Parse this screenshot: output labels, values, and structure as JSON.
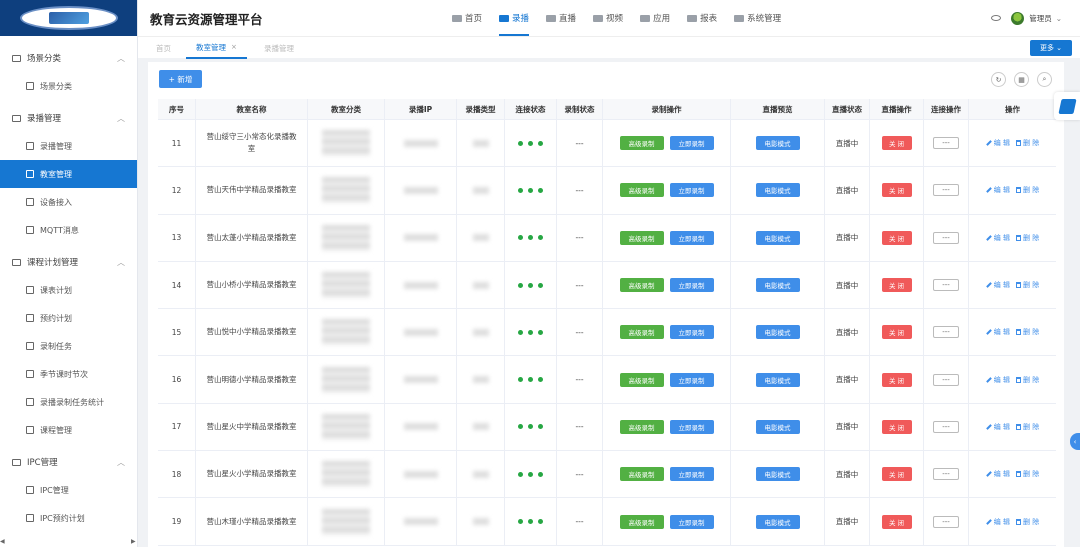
{
  "header": {
    "title": "教育云资源管理平台",
    "nav": [
      {
        "label": "首页",
        "icon": "home-icon",
        "active": false
      },
      {
        "label": "录播",
        "icon": "camera-icon",
        "active": true
      },
      {
        "label": "直播",
        "icon": "live-icon",
        "active": false
      },
      {
        "label": "视频",
        "icon": "video-icon",
        "active": false
      },
      {
        "label": "应用",
        "icon": "apps-icon",
        "active": false
      },
      {
        "label": "报表",
        "icon": "report-icon",
        "active": false
      },
      {
        "label": "系统管理",
        "icon": "system-icon",
        "active": false
      }
    ],
    "user": "管理员"
  },
  "sidebar": {
    "groups": [
      {
        "label": "场景分类",
        "items": [
          {
            "label": "场景分类"
          }
        ]
      },
      {
        "label": "录播管理",
        "items": [
          {
            "label": "录播管理"
          },
          {
            "label": "教室管理"
          },
          {
            "label": "设备接入"
          },
          {
            "label": "MQTT消息"
          }
        ]
      },
      {
        "label": "课程计划管理",
        "items": [
          {
            "label": "课表计划"
          },
          {
            "label": "预约计划"
          },
          {
            "label": "录制任务"
          },
          {
            "label": "季节课时节次"
          },
          {
            "label": "录播录制任务统计"
          },
          {
            "label": "课程管理"
          }
        ]
      },
      {
        "label": "IPC管理",
        "items": [
          {
            "label": "IPC管理"
          },
          {
            "label": "IPC预约计划"
          }
        ]
      }
    ],
    "active_item": "教室管理"
  },
  "tabs": [
    {
      "label": "首页"
    },
    {
      "label": "教室管理",
      "close": "×"
    },
    {
      "label": "录播管理"
    }
  ],
  "toolbar": {
    "more_label": "更多",
    "add_label": "+ 新增",
    "refresh_icon": "↻",
    "grid_icon": "▦",
    "search_icon": "⌕"
  },
  "table": {
    "headers": [
      "序号",
      "教室名称",
      "教室分类",
      "录播IP",
      "录播类型",
      "连接状态",
      "录制状态",
      "录制操作",
      "直播预览",
      "直播状态",
      "直播操作",
      "连接操作",
      "操作"
    ],
    "rows": [
      {
        "seq": "11",
        "name": "营山绥守三小常态化录播教室",
        "record_status": "---",
        "live_status": "直播中"
      },
      {
        "seq": "12",
        "name": "营山天伟中学精品录播教室",
        "record_status": "---",
        "live_status": "直播中"
      },
      {
        "seq": "13",
        "name": "营山太蓬小学精品录播教室",
        "record_status": "---",
        "live_status": "直播中"
      },
      {
        "seq": "14",
        "name": "营山小桥小学精品录播教室",
        "record_status": "---",
        "live_status": "直播中"
      },
      {
        "seq": "15",
        "name": "营山悦中小学精品录播教室",
        "record_status": "---",
        "live_status": "直播中"
      },
      {
        "seq": "16",
        "name": "营山明德小学精品录播教室",
        "record_status": "---",
        "live_status": "直播中"
      },
      {
        "seq": "17",
        "name": "营山星火中学精品录播教室",
        "record_status": "---",
        "live_status": "直播中"
      },
      {
        "seq": "18",
        "name": "营山星火小学精品录播教室",
        "record_status": "---",
        "live_status": "直播中"
      },
      {
        "seq": "19",
        "name": "营山木瑾小学精品录播教室",
        "record_status": "---",
        "live_status": "直播中"
      }
    ],
    "btn_advanced_record": "高级录制",
    "btn_instant_record": "立即录制",
    "btn_movie_mode": "电影模式",
    "btn_close": "关 闭",
    "btn_connect": "---",
    "btn_edit": "编 辑",
    "btn_delete": "删 除"
  },
  "colors": {
    "primary": "#1677d2",
    "logo_bg": "#0e3f7e",
    "green": "#52b043",
    "red": "#f05a5a",
    "status_dot": "#27a744"
  }
}
